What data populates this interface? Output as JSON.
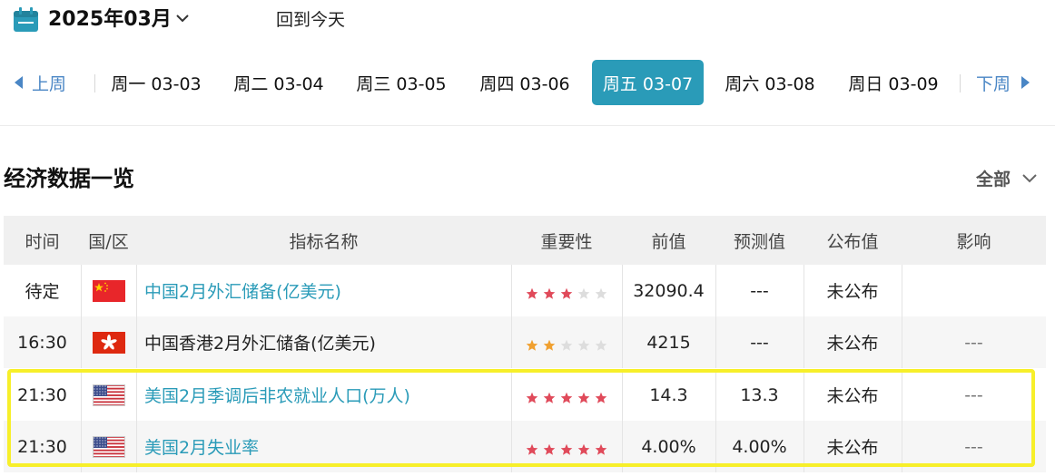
{
  "header": {
    "month_label": "2025年03月",
    "today_label": "回到今天",
    "icons": [
      "calendar-icon",
      "chevron-down-icon"
    ]
  },
  "week_nav": {
    "prev_label": "上周",
    "next_label": "下周",
    "days": [
      {
        "label": "周一 03-03",
        "active": false
      },
      {
        "label": "周二 03-04",
        "active": false
      },
      {
        "label": "周三 03-05",
        "active": false
      },
      {
        "label": "周四 03-06",
        "active": false
      },
      {
        "label": "周五 03-07",
        "active": true
      },
      {
        "label": "周六 03-08",
        "active": false
      },
      {
        "label": "周日 03-09",
        "active": false
      }
    ],
    "active_color": "#2a9bb8"
  },
  "section": {
    "title": "经济数据一览",
    "filter_label": "全部"
  },
  "table": {
    "columns": [
      "时间",
      "国/区",
      "指标名称",
      "重要性",
      "前值",
      "预测值",
      "公布值",
      "影响"
    ],
    "rows": [
      {
        "time": "待定",
        "flag": "cn-flag-icon",
        "name": "中国2月外汇储备(亿美元)",
        "name_link": true,
        "importance": 3,
        "star_color": "red",
        "previous": "32090.4",
        "forecast": "---",
        "actual": "未公布",
        "impact": ""
      },
      {
        "time": "16:30",
        "flag": "hk-flag-icon",
        "name": "中国香港2月外汇储备(亿美元)",
        "name_link": false,
        "importance": 2,
        "star_color": "orange",
        "previous": "4215",
        "forecast": "---",
        "actual": "未公布",
        "impact": "---"
      },
      {
        "time": "21:30",
        "flag": "us-flag-icon",
        "name": "美国2月季调后非农就业人口(万人)",
        "name_link": true,
        "importance": 5,
        "star_color": "red",
        "previous": "14.3",
        "forecast": "13.3",
        "actual": "未公布",
        "impact": "---"
      },
      {
        "time": "21:30",
        "flag": "us-flag-icon",
        "name": "美国2月失业率",
        "name_link": true,
        "importance": 5,
        "star_color": "red",
        "previous": "4.00%",
        "forecast": "4.00%",
        "actual": "未公布",
        "impact": "---"
      }
    ],
    "colors": {
      "link": "#2a9bb8",
      "star_red": "#e04a5a",
      "star_orange": "#f0a030",
      "star_empty": "#dddddd",
      "highlight": "#f7ef2a"
    }
  }
}
